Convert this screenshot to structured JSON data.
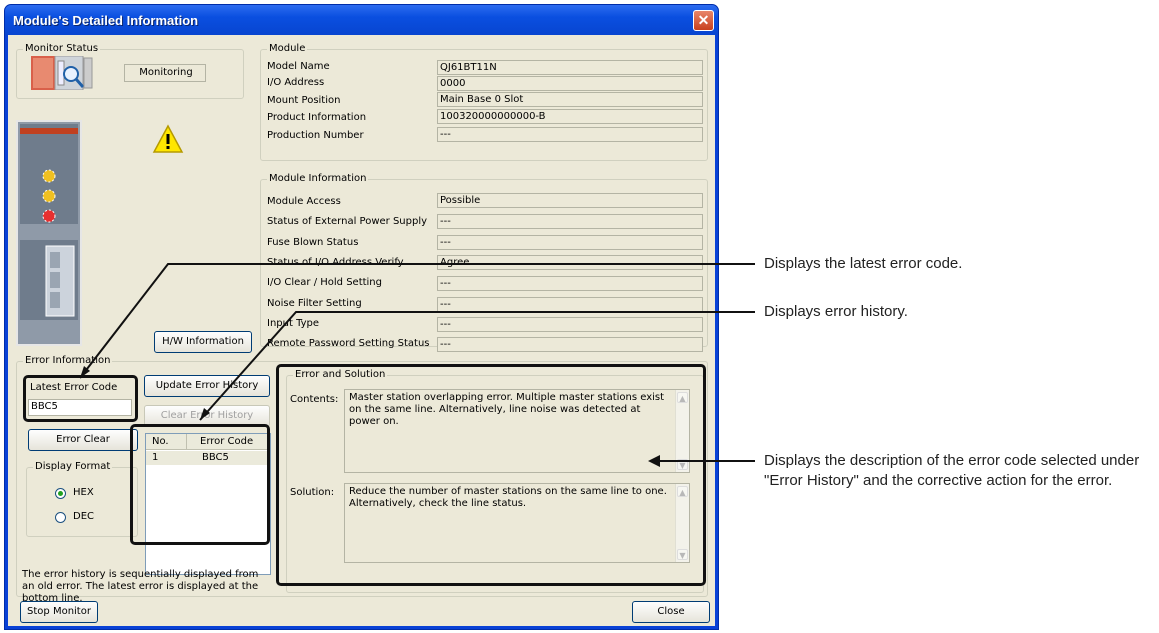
{
  "window": {
    "title": "Module's Detailed Information",
    "close_glyph": "✕"
  },
  "monitor": {
    "group_label": "Monitor Status",
    "status": "Monitoring"
  },
  "module": {
    "group_label": "Module",
    "rows": [
      {
        "label": "Model Name",
        "value": "QJ61BT11N"
      },
      {
        "label": "I/O Address",
        "value": "0000"
      },
      {
        "label": "Mount Position",
        "value": "Main Base  0 Slot"
      },
      {
        "label": "Product Information",
        "value": "100320000000000-B"
      },
      {
        "label": "Production Number",
        "value": "---"
      }
    ]
  },
  "module_info": {
    "group_label": "Module Information",
    "rows": [
      {
        "label": "Module Access",
        "value": "Possible"
      },
      {
        "label": "Status of External Power Supply",
        "value": "---"
      },
      {
        "label": "Fuse Blown Status",
        "value": "---"
      },
      {
        "label": "Status of I/O Address Verify",
        "value": "Agree"
      },
      {
        "label": "I/O Clear / Hold Setting",
        "value": "---"
      },
      {
        "label": "Noise Filter Setting",
        "value": "---"
      },
      {
        "label": "Input Type",
        "value": "---"
      },
      {
        "label": "Remote Password Setting Status",
        "value": "---"
      }
    ]
  },
  "hw_button": "H/W Information",
  "error_info": {
    "group_label": "Error Information",
    "latest_label": "Latest Error Code",
    "latest_value": "BBC5",
    "update_button": "Update Error History",
    "clear_history_button": "Clear Error History",
    "error_clear_button": "Error Clear",
    "display_format": {
      "label": "Display Format",
      "hex": "HEX",
      "dec": "DEC",
      "selected": "HEX"
    },
    "history_headers": {
      "no": "No.",
      "code": "Error Code"
    },
    "history": [
      {
        "no": "1",
        "code": "BBC5"
      }
    ],
    "note": "The error history is sequentially displayed from an old error. The latest error is displayed at the bottom line."
  },
  "solution": {
    "group_label": "Error and Solution",
    "contents_label": "Contents:",
    "contents": "Master station overlapping error. Multiple master stations exist on the same line. Alternatively, line noise was detected at power on.",
    "solution_label": "Solution:",
    "solution": "Reduce the number of master stations on the same line to one. Alternatively, check the line status."
  },
  "footer": {
    "stop_button": "Stop Monitor",
    "close_button": "Close"
  },
  "annotations": {
    "latest": "Displays the latest error code.",
    "history": "Displays error history.",
    "description": "Displays the description of the error code selected under \"Error History\" and the corrective action for the error."
  },
  "colors": {
    "title_bar": "#0a4fe0",
    "client": "#ece9d8",
    "radio_dot": "#21a121"
  }
}
